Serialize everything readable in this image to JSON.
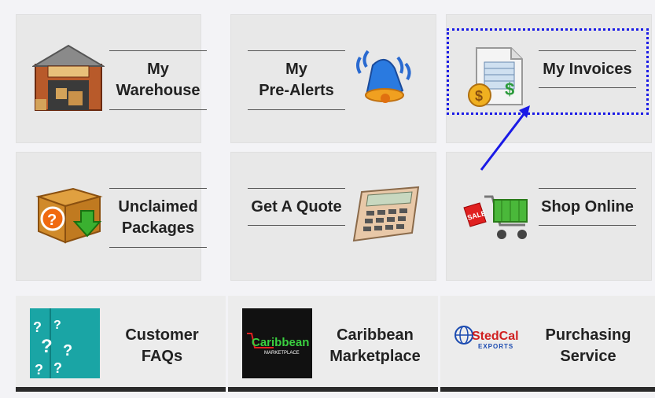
{
  "tiles": [
    {
      "label_line1": "My",
      "label_line2": "Warehouse",
      "icon": "warehouse-icon"
    },
    {
      "label_line1": "My",
      "label_line2": "Pre-Alerts",
      "icon": "bell-icon"
    },
    {
      "label_line1": "My Invoices",
      "icon": "invoice-icon"
    },
    {
      "label_line1": "Unclaimed",
      "label_line2": "Packages",
      "icon": "package-icon"
    },
    {
      "label_line1": "Get A Quote",
      "icon": "calculator-icon"
    },
    {
      "label_line1": "Shop Online",
      "icon": "shopping-cart-icon"
    }
  ],
  "bottom": [
    {
      "line1": "Customer",
      "line2": "FAQs",
      "image_text": "?"
    },
    {
      "line1": "Caribbean",
      "line2": "Marketplace",
      "logo_word1": "Caribbean",
      "logo_word2": "MARKETPLACE"
    },
    {
      "line1": "Purchasing",
      "line2": "Service",
      "logo_word1": "StedCal",
      "logo_word2": "EXPORTS"
    }
  ],
  "colors": {
    "highlight": "#1a1ae6",
    "tile_bg": "#e8e8e8",
    "faq_bg": "#1aa5a5"
  }
}
